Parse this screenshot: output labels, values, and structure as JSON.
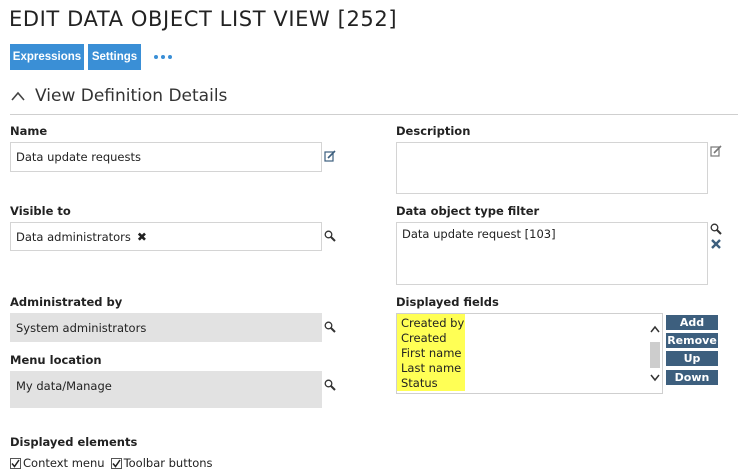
{
  "page": {
    "title": "EDIT DATA OBJECT LIST VIEW [252]"
  },
  "toolbar": {
    "expressions_label": "Expressions",
    "settings_label": "Settings",
    "more_icon": "ellipsis-icon"
  },
  "section": {
    "title": "View Definition Details",
    "toggle_icon": "chevron-up-icon"
  },
  "form": {
    "name": {
      "label": "Name",
      "value": "Data update requests"
    },
    "description": {
      "label": "Description",
      "value": ""
    },
    "visible_to": {
      "label": "Visible to",
      "value": "Data administrators",
      "remove_icon": "remove-x-icon"
    },
    "type_filter": {
      "label": "Data object type filter",
      "value": "Data update request [103]"
    },
    "administrated_by": {
      "label": "Administrated by",
      "value": "System administrators"
    },
    "menu_location": {
      "label": "Menu location",
      "value": "My data/Manage"
    },
    "displayed_fields": {
      "label": "Displayed fields",
      "items": [
        "Created by",
        "Created",
        "First name",
        "Last name",
        "Status"
      ],
      "highlight_color": "#ffff55"
    },
    "field_buttons": {
      "add": "Add",
      "remove": "Remove",
      "up": "Up",
      "down": "Down"
    },
    "displayed_elements": {
      "label": "Displayed elements",
      "context_menu": {
        "label": "Context menu",
        "checked": true
      },
      "toolbar_buttons": {
        "label": "Toolbar buttons",
        "checked": true
      }
    }
  },
  "colors": {
    "accent": "#3a8fd6",
    "dark_button": "#3d5f7e",
    "readonly_field": "#e2e2e2"
  }
}
